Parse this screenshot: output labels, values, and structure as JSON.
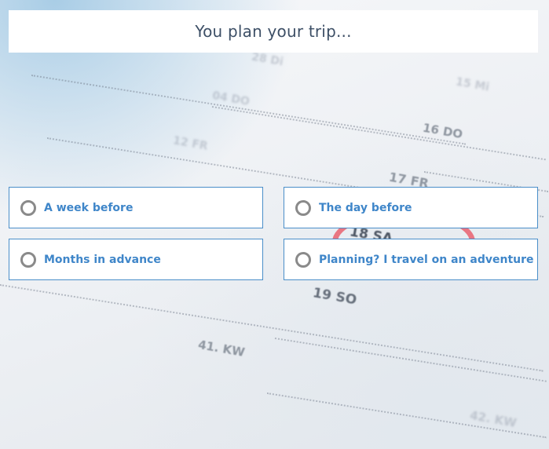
{
  "question": {
    "title": "You plan your trip..."
  },
  "options": [
    {
      "label": "A week before"
    },
    {
      "label": "The day before"
    },
    {
      "label": "Months in advance"
    },
    {
      "label": "Planning? I travel on an adventure"
    }
  ],
  "colors": {
    "accent": "#3f86c9",
    "option_border": "#4a8ec9",
    "title_text": "#3d4f66",
    "radio_border": "#8a8a8a",
    "highlight_ring": "#e9606f"
  }
}
